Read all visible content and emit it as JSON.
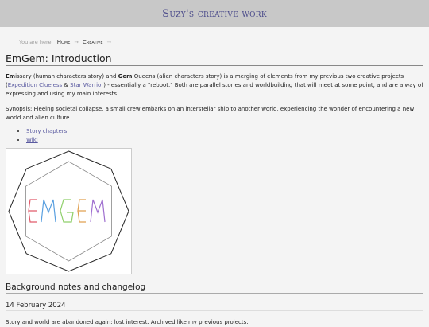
{
  "site": {
    "title": "Suzy's creative work"
  },
  "breadcrumb": {
    "prefix": "You are here:",
    "items": [
      {
        "label": "Home"
      },
      {
        "label": "Creative"
      }
    ],
    "sep": "→"
  },
  "page": {
    "title": "EmGem: Introduction",
    "intro": {
      "em_bold": "Em",
      "em_rest": "issary (human characters story) and ",
      "gem_bold": "Gem",
      "gem_rest": " Queens (alien characters story) is a merging of elements from my previous two creative projects (",
      "link1": "Expedition Clueless",
      "amp": " & ",
      "link2": "Star Warrior",
      "tail": ") - essentially a \"reboot.\" Both are parallel stories and worldbuilding that will meet at some point, and are a way of expressing and using my main interests."
    },
    "synopsis": "Synopsis: Fleeing societal collapse, a small crew embarks on an interstellar ship to another world, experiencing the wonder of encountering a new world and alien culture.",
    "links": [
      {
        "label": "Story chapters"
      },
      {
        "label": "Wiki"
      }
    ],
    "logo": {
      "text": "EMGEM",
      "letter_colors": [
        "#e05a6a",
        "#5aa0e0",
        "#8fcf6a",
        "#e0a050",
        "#a070d0"
      ]
    },
    "section_title": "Background notes and changelog",
    "entry_date": "14 February 2024",
    "entry_text": "Story and world are abandoned again: lost interest. Archived like my previous projects."
  }
}
